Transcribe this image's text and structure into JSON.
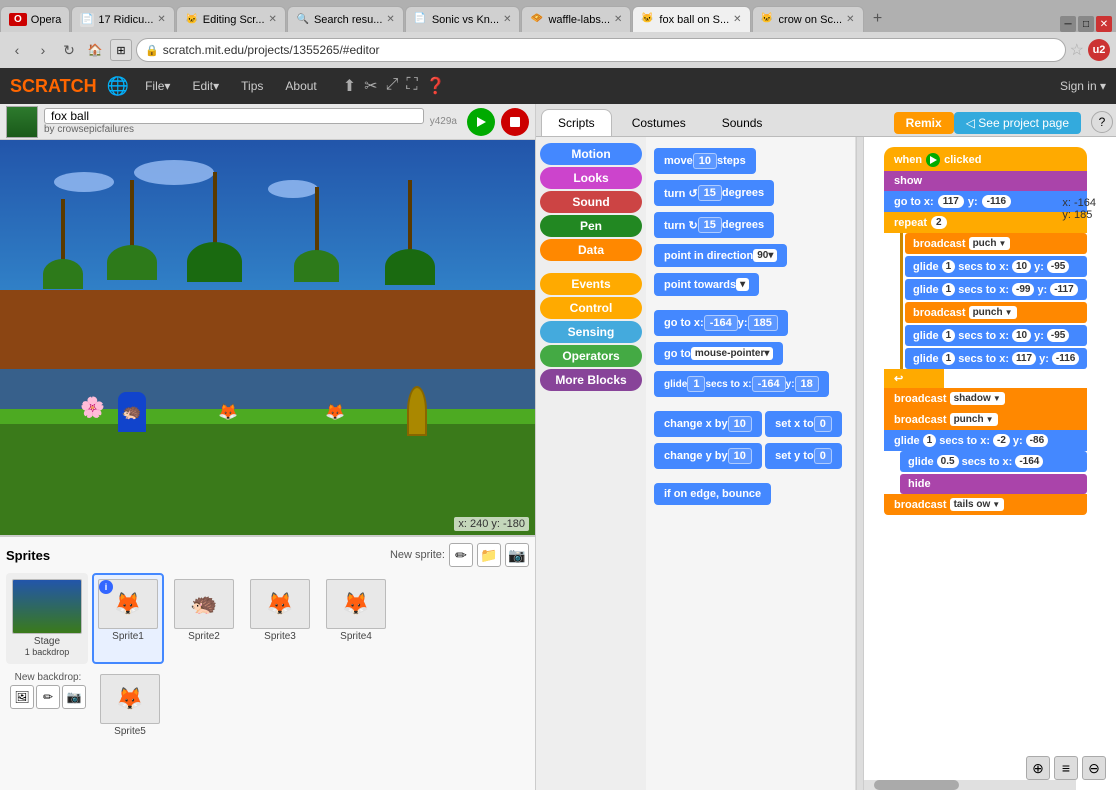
{
  "browser": {
    "tabs": [
      {
        "id": "opera",
        "label": "Opera",
        "active": false,
        "favicon": "O"
      },
      {
        "id": "17rid",
        "label": "17 Ridicu...",
        "active": false,
        "favicon": "📄"
      },
      {
        "id": "editing",
        "label": "Editing Scr...",
        "active": false,
        "favicon": "🐱"
      },
      {
        "id": "search",
        "label": "Search resu...",
        "active": false,
        "favicon": "🔍"
      },
      {
        "id": "sonic",
        "label": "Sonic vs Kn...",
        "active": false,
        "favicon": "📄"
      },
      {
        "id": "waffle",
        "label": "waffle-labs...",
        "active": false,
        "favicon": "🧇"
      },
      {
        "id": "foxball",
        "label": "fox ball on S...",
        "active": true,
        "favicon": "🐱"
      },
      {
        "id": "crow",
        "label": "crow on Sc...",
        "active": false,
        "favicon": "🐱"
      }
    ],
    "address": "scratch.mit.edu/projects/1355265/#editor"
  },
  "scratch": {
    "header": {
      "logo": "SCRATCH",
      "menu_file": "File▾",
      "menu_edit": "Edit▾",
      "menu_tips": "Tips",
      "menu_about": "About",
      "signin": "Sign in ▾"
    },
    "stage": {
      "name": "fox ball",
      "author": "by crowsepicfailures",
      "coords": "x: 240  y: -180",
      "y_label": "y429a"
    },
    "tabs": {
      "scripts": "Scripts",
      "costumes": "Costumes",
      "sounds": "Sounds"
    },
    "remix_btn": "Remix",
    "see_project_btn": "◁ See project page",
    "categories": [
      {
        "label": "Motion",
        "class": "cat-motion"
      },
      {
        "label": "Looks",
        "class": "cat-looks"
      },
      {
        "label": "Sound",
        "class": "cat-sound"
      },
      {
        "label": "Pen",
        "class": "cat-pen"
      },
      {
        "label": "Data",
        "class": "cat-data"
      },
      {
        "label": "Events",
        "class": "cat-events"
      },
      {
        "label": "Control",
        "class": "cat-control"
      },
      {
        "label": "Sensing",
        "class": "cat-sensing"
      },
      {
        "label": "Operators",
        "class": "cat-operators"
      },
      {
        "label": "More Blocks",
        "class": "cat-more"
      }
    ],
    "blocks": [
      {
        "label": "move 10 steps",
        "type": "motion"
      },
      {
        "label": "turn ↺ 15 degrees",
        "type": "motion"
      },
      {
        "label": "turn ↻ 15 degrees",
        "type": "motion"
      },
      {
        "label": "point in direction 90▾",
        "type": "motion"
      },
      {
        "label": "point towards ▾",
        "type": "motion"
      },
      {
        "label": "go to x: -164 y: 185",
        "type": "motion"
      },
      {
        "label": "go to mouse-pointer ▾",
        "type": "motion"
      },
      {
        "label": "glide 1 secs to x: -164 y: 18",
        "type": "motion"
      },
      {
        "label": "change x by 10",
        "type": "motion"
      },
      {
        "label": "set x to 0",
        "type": "motion"
      },
      {
        "label": "change y by 10",
        "type": "motion"
      },
      {
        "label": "set y to 0",
        "type": "motion"
      },
      {
        "label": "if on edge, bounce",
        "type": "motion"
      }
    ],
    "script": {
      "when_clicked": "when 🚩 clicked",
      "show": "show",
      "go_to": "go to x: 117  y: -116",
      "repeat": "repeat",
      "repeat_val": "2",
      "broadcast_puch": "broadcast puch ▾",
      "glide1": "glide 1 secs to x: 10  y: -95",
      "glide2": "glide 1 secs to x: -99  y: -117",
      "broadcast_punch1": "broadcast punch ▾",
      "glide3": "glide 1 secs to x: 10  y: -95",
      "glide4": "glide 1 secs to x: 117  y: -116",
      "broadcast_shadow": "broadcast shadow ▾",
      "broadcast_punch2": "broadcast punch ▾",
      "glide5": "glide 1 secs to x: -2  y: -86",
      "glide6": "glide 0.5 secs to x: -164",
      "hide": "hide",
      "broadcast_tails": "broadcast tails ow ▾",
      "x_coord": "x: -164",
      "y_coord": "y: 185"
    },
    "sprites": {
      "title": "Sprites",
      "new_sprite": "New sprite:",
      "items": [
        {
          "id": "stage",
          "label": "Stage\n1 backdrop",
          "type": "stage"
        },
        {
          "id": "sprite1",
          "label": "Sprite1",
          "selected": true,
          "has_badge": true
        },
        {
          "id": "sprite2",
          "label": "Sprite2"
        },
        {
          "id": "sprite3",
          "label": "Sprite3"
        },
        {
          "id": "sprite4",
          "label": "Sprite4"
        }
      ],
      "sprite5": {
        "label": "Sprite5"
      },
      "new_backdrop": "New backdrop:"
    }
  }
}
